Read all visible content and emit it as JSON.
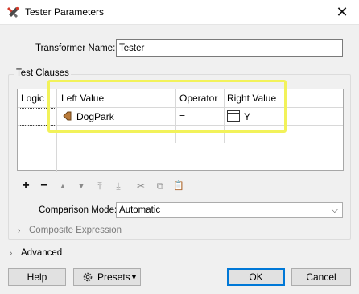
{
  "window": {
    "title": "Tester Parameters",
    "close_glyph": "✕",
    "app_icon": "fme-transformer-icon"
  },
  "transformer": {
    "name_label": "Transformer Name:",
    "name_value": "Tester"
  },
  "test_clauses": {
    "group_label": "Test Clauses",
    "columns": [
      "Logic",
      "Left Value",
      "Operator",
      "Right Value"
    ],
    "rows": [
      {
        "logic": "",
        "left_value": "DogPark",
        "operator": "=",
        "right_value": "Y"
      }
    ],
    "highlight_color": "#f2f25a"
  },
  "toolbar": {
    "add_glyph": "+",
    "remove_glyph": "−",
    "move_up_glyph": "▲",
    "move_down_glyph": "▼",
    "move_top_glyph": "⤒",
    "move_bottom_glyph": "⤓",
    "cut_glyph": "✂",
    "copy_glyph": "⧉",
    "paste_glyph": "📋"
  },
  "comparison_mode": {
    "label": "Comparison Mode:",
    "value": "Automatic"
  },
  "composite_expression": {
    "label": "Composite Expression"
  },
  "advanced": {
    "label": "Advanced"
  },
  "buttons": {
    "help": "Help",
    "presets": "Presets",
    "ok": "OK",
    "cancel": "Cancel"
  }
}
